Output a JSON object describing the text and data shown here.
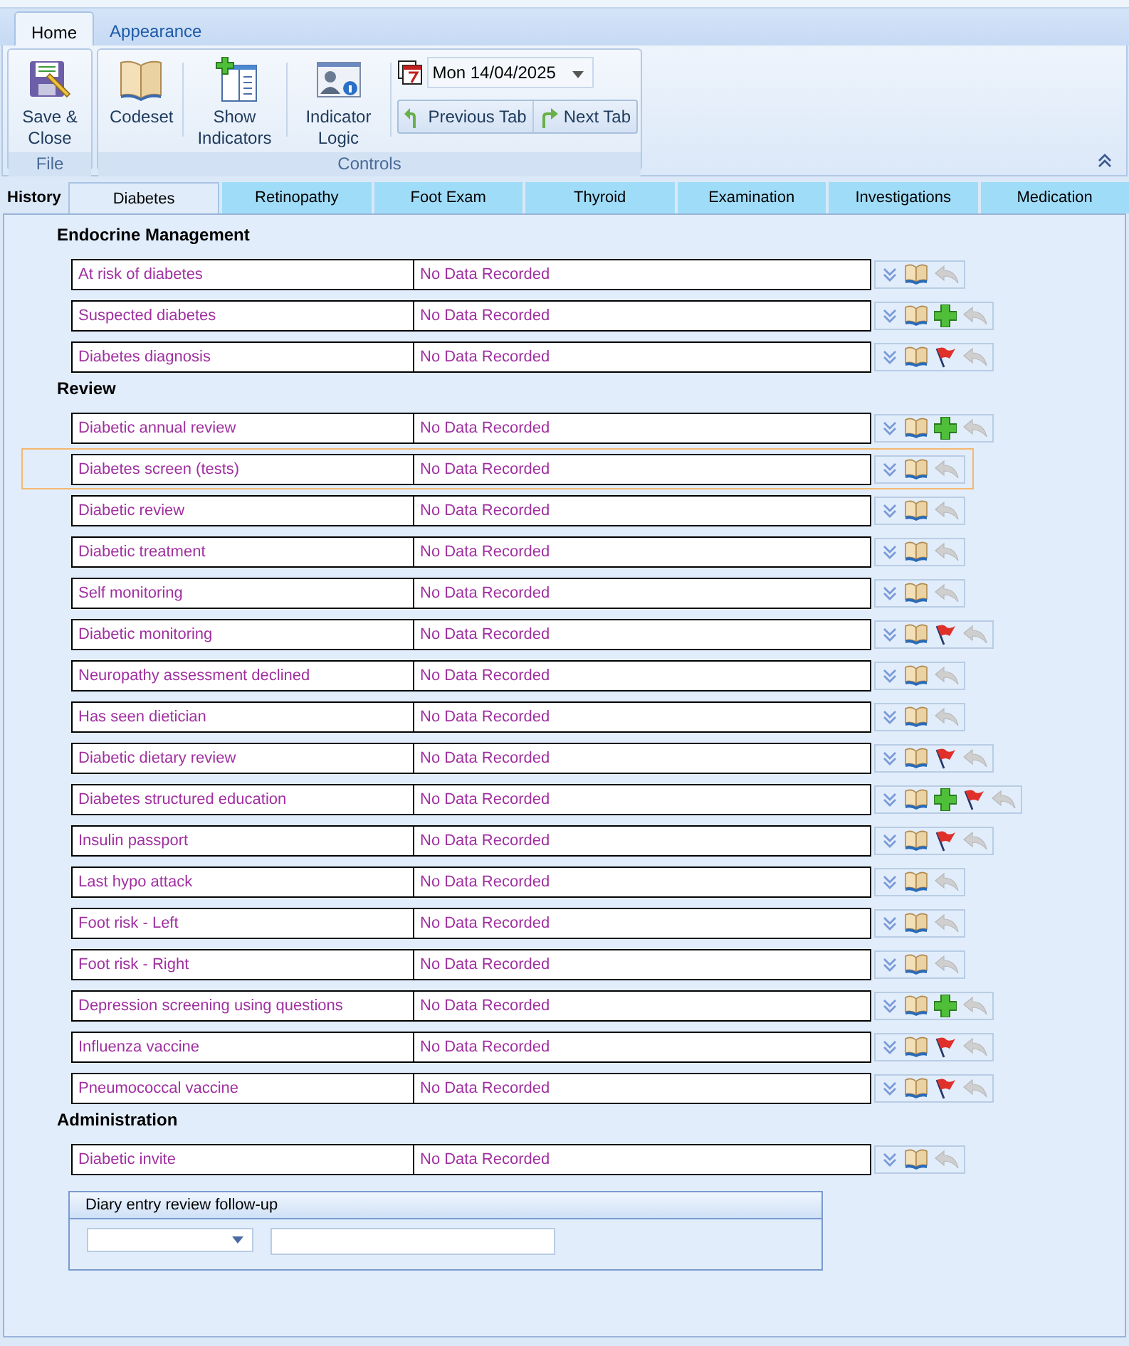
{
  "ribbon_tabs": [
    {
      "label": "Home",
      "selected": true
    },
    {
      "label": "Appearance",
      "selected": false
    }
  ],
  "ribbon": {
    "file_group": {
      "label": "File",
      "buttons": [
        {
          "kind": "save",
          "label": "Save & Close"
        }
      ]
    },
    "controls_group": {
      "label": "Controls",
      "buttons": [
        {
          "kind": "codeset",
          "label": "Codeset"
        },
        {
          "kind": "indicators",
          "label": "Show Indicators"
        },
        {
          "kind": "logic",
          "label": "Indicator Logic"
        }
      ],
      "date": "Mon 14/04/2025",
      "previous_tab": "Previous Tab",
      "next_tab": "Next Tab"
    }
  },
  "tabs": [
    {
      "label": "History",
      "selected": false,
      "kind": "plain"
    },
    {
      "label": "Diabetes",
      "selected": true,
      "kind": "page"
    },
    {
      "label": "Retinopathy",
      "selected": false,
      "kind": "page"
    },
    {
      "label": "Foot Exam",
      "selected": false,
      "kind": "page"
    },
    {
      "label": "Thyroid",
      "selected": false,
      "kind": "page"
    },
    {
      "label": "Examination",
      "selected": false,
      "kind": "page"
    },
    {
      "label": "Investigations",
      "selected": false,
      "kind": "page"
    },
    {
      "label": "Medication",
      "selected": false,
      "kind": "page"
    }
  ],
  "sections": [
    {
      "title": "Endocrine Management",
      "rows": [
        {
          "label": "At risk of diabetes",
          "value": "No Data Recorded",
          "add": false,
          "flag": false,
          "selected": false
        },
        {
          "label": "Suspected diabetes",
          "value": "No Data Recorded",
          "add": true,
          "flag": false,
          "selected": false
        },
        {
          "label": "Diabetes diagnosis",
          "value": "No Data Recorded",
          "add": false,
          "flag": true,
          "selected": false
        }
      ]
    },
    {
      "title": "Review",
      "rows": [
        {
          "label": "Diabetic annual review",
          "value": "No Data Recorded",
          "add": true,
          "flag": false,
          "selected": false
        },
        {
          "label": "Diabetes screen (tests)",
          "value": "No Data Recorded",
          "add": false,
          "flag": false,
          "selected": true
        },
        {
          "label": "Diabetic review",
          "value": "No Data Recorded",
          "add": false,
          "flag": false,
          "selected": false
        },
        {
          "label": "Diabetic treatment",
          "value": "No Data Recorded",
          "add": false,
          "flag": false,
          "selected": false
        },
        {
          "label": "Self monitoring",
          "value": "No Data Recorded",
          "add": false,
          "flag": false,
          "selected": false
        },
        {
          "label": "Diabetic monitoring",
          "value": "No Data Recorded",
          "add": false,
          "flag": true,
          "selected": false
        },
        {
          "label": "Neuropathy assessment declined",
          "value": "No Data Recorded",
          "add": false,
          "flag": false,
          "selected": false
        },
        {
          "label": "Has seen dietician",
          "value": "No Data Recorded",
          "add": false,
          "flag": false,
          "selected": false
        },
        {
          "label": "Diabetic dietary review",
          "value": "No Data Recorded",
          "add": false,
          "flag": true,
          "selected": false
        },
        {
          "label": "Diabetes structured education",
          "value": "No Data Recorded",
          "add": true,
          "flag": true,
          "selected": false
        },
        {
          "label": "Insulin passport",
          "value": "No Data Recorded",
          "add": false,
          "flag": true,
          "selected": false
        },
        {
          "label": "Last hypo attack",
          "value": "No Data Recorded",
          "add": false,
          "flag": false,
          "selected": false
        },
        {
          "label": "Foot risk - Left",
          "value": "No Data Recorded",
          "add": false,
          "flag": false,
          "selected": false
        },
        {
          "label": "Foot risk - Right",
          "value": "No Data Recorded",
          "add": false,
          "flag": false,
          "selected": false
        },
        {
          "label": "Depression screening using questions",
          "value": "No Data Recorded",
          "add": true,
          "flag": false,
          "selected": false
        },
        {
          "label": "Influenza vaccine",
          "value": "No Data Recorded",
          "add": false,
          "flag": true,
          "selected": false
        },
        {
          "label": "Pneumococcal vaccine",
          "value": "No Data Recorded",
          "add": false,
          "flag": true,
          "selected": false
        }
      ]
    },
    {
      "title": "Administration",
      "rows": [
        {
          "label": "Diabetic invite",
          "value": "No Data Recorded",
          "add": false,
          "flag": false,
          "selected": false
        }
      ]
    }
  ],
  "diary": {
    "title": "Diary entry review follow-up"
  }
}
